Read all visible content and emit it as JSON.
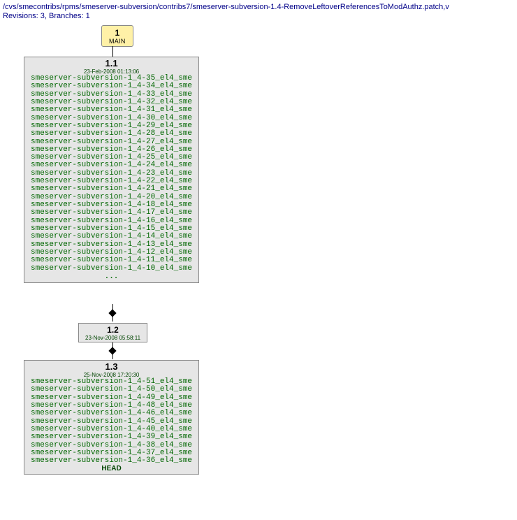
{
  "path": "/cvs/smecontribs/rpms/smeserver-subversion/contribs7/smeserver-subversion-1.4-RemoveLeftoverReferencesToModAuthz.patch,v",
  "info": "Revisions: 3, Branches: 1",
  "mainBox": {
    "num": "1",
    "label": "MAIN"
  },
  "rev11": {
    "version": "1.1",
    "date": "23-Feb-2008 01:13:06",
    "tags": [
      "smeserver-subversion-1_4-35_el4_sme",
      "smeserver-subversion-1_4-34_el4_sme",
      "smeserver-subversion-1_4-33_el4_sme",
      "smeserver-subversion-1_4-32_el4_sme",
      "smeserver-subversion-1_4-31_el4_sme",
      "smeserver-subversion-1_4-30_el4_sme",
      "smeserver-subversion-1_4-29_el4_sme",
      "smeserver-subversion-1_4-28_el4_sme",
      "smeserver-subversion-1_4-27_el4_sme",
      "smeserver-subversion-1_4-26_el4_sme",
      "smeserver-subversion-1_4-25_el4_sme",
      "smeserver-subversion-1_4-24_el4_sme",
      "smeserver-subversion-1_4-23_el4_sme",
      "smeserver-subversion-1_4-22_el4_sme",
      "smeserver-subversion-1_4-21_el4_sme",
      "smeserver-subversion-1_4-20_el4_sme",
      "smeserver-subversion-1_4-18_el4_sme",
      "smeserver-subversion-1_4-17_el4_sme",
      "smeserver-subversion-1_4-16_el4_sme",
      "smeserver-subversion-1_4-15_el4_sme",
      "smeserver-subversion-1_4-14_el4_sme",
      "smeserver-subversion-1_4-13_el4_sme",
      "smeserver-subversion-1_4-12_el4_sme",
      "smeserver-subversion-1_4-11_el4_sme",
      "smeserver-subversion-1_4-10_el4_sme"
    ],
    "more": "..."
  },
  "rev12": {
    "version": "1.2",
    "date": "23-Nov-2008 05:58:11"
  },
  "rev13": {
    "version": "1.3",
    "date": "25-Nov-2008 17:20:30",
    "tags": [
      "smeserver-subversion-1_4-51_el4_sme",
      "smeserver-subversion-1_4-50_el4_sme",
      "smeserver-subversion-1_4-49_el4_sme",
      "smeserver-subversion-1_4-48_el4_sme",
      "smeserver-subversion-1_4-46_el4_sme",
      "smeserver-subversion-1_4-45_el4_sme",
      "smeserver-subversion-1_4-40_el4_sme",
      "smeserver-subversion-1_4-39_el4_sme",
      "smeserver-subversion-1_4-38_el4_sme",
      "smeserver-subversion-1_4-37_el4_sme",
      "smeserver-subversion-1_4-36_el4_sme"
    ],
    "head": "HEAD"
  }
}
